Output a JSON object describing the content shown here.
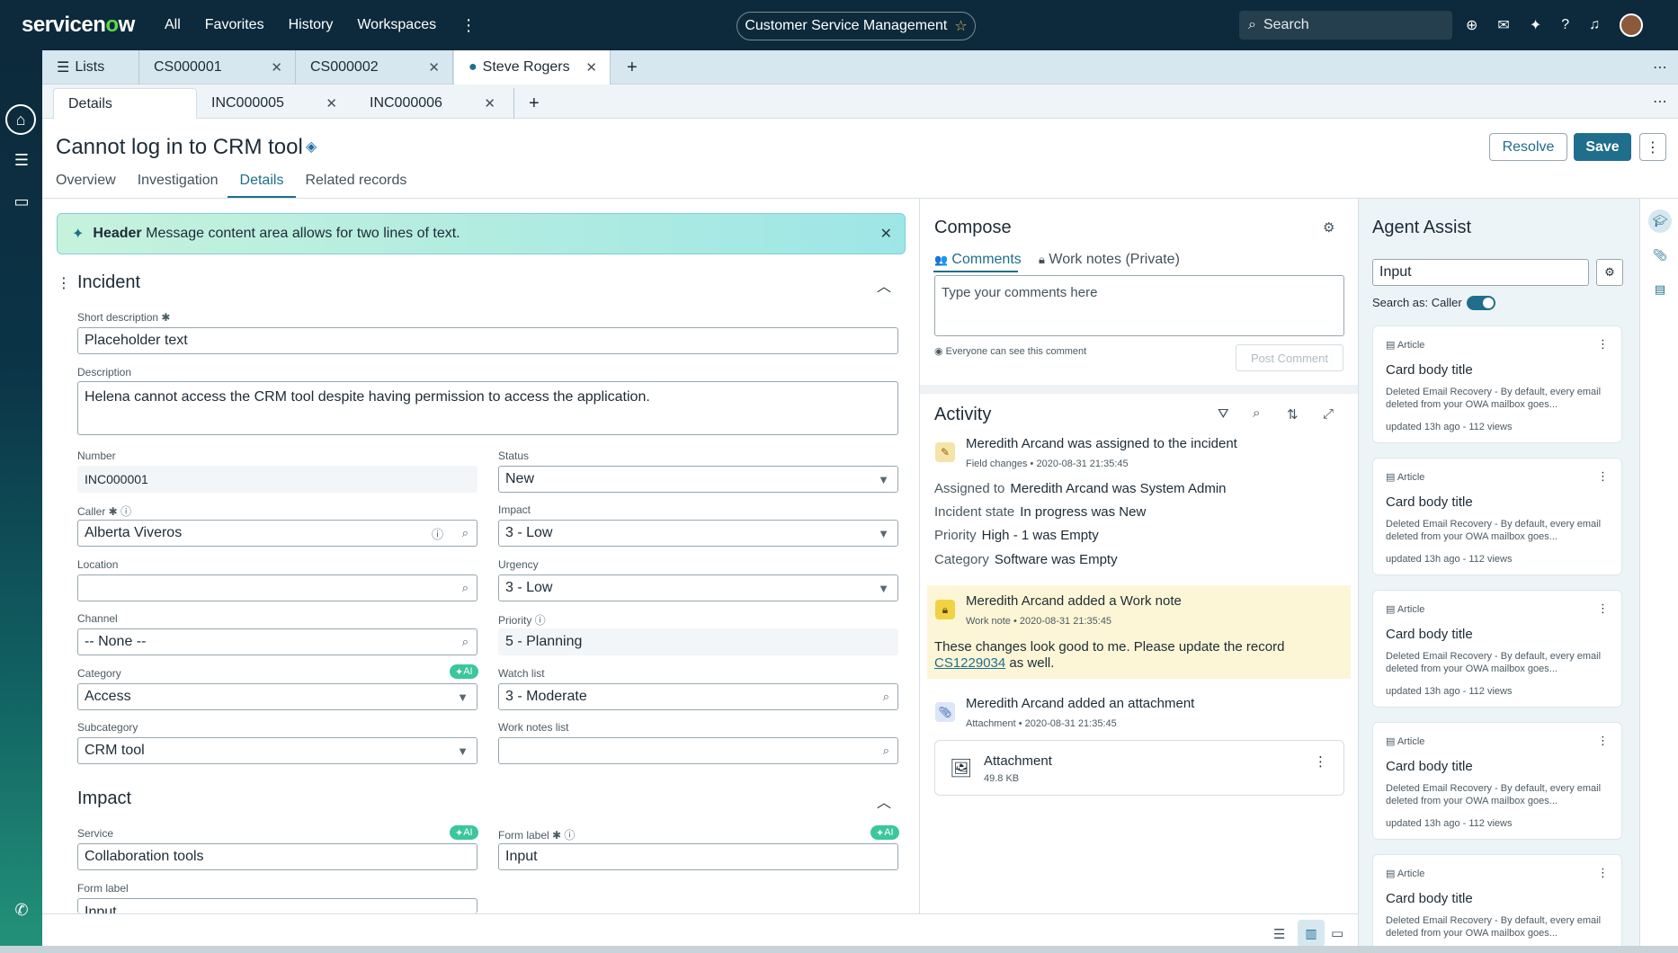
{
  "topbar": {
    "logo": "servicenow",
    "nav": [
      "All",
      "Favorites",
      "History",
      "Workspaces"
    ],
    "workspace": "Customer Service Management",
    "search_placeholder": "Search"
  },
  "tabs_primary": [
    {
      "label": "Lists",
      "icon": "list-icon"
    },
    {
      "label": "CS000001"
    },
    {
      "label": "CS000002"
    },
    {
      "label": "Steve Rogers",
      "icon": "chat-icon",
      "active": true
    }
  ],
  "tabs_secondary": [
    {
      "label": "Details",
      "active": true
    },
    {
      "label": "INC000005"
    },
    {
      "label": "INC000006"
    }
  ],
  "record": {
    "title": "Cannot log in to CRM tool",
    "resolve_label": "Resolve",
    "save_label": "Save",
    "subtabs": [
      "Overview",
      "Investigation",
      "Details",
      "Related records"
    ],
    "active_subtab": "Details"
  },
  "banner": {
    "header": "Header",
    "message": "Message content area allows for two lines of text."
  },
  "incident": {
    "section_title": "Incident",
    "short_description_label": "Short description",
    "short_description": "Placeholder text",
    "description_label": "Description",
    "description": "Helena cannot access the CRM tool despite having permission to access the application.",
    "number_label": "Number",
    "number": "INC000001",
    "status_label": "Status",
    "status": "New",
    "caller_label": "Caller",
    "caller": "Alberta Viveros",
    "impact_label": "Impact",
    "impact": "3 - Low",
    "location_label": "Location",
    "location": "",
    "urgency_label": "Urgency",
    "urgency": "3 - Low",
    "channel_label": "Channel",
    "channel": "-- None --",
    "priority_label": "Priority",
    "priority": "5 - Planning",
    "category_label": "Category",
    "category": "Access",
    "watch_list_label": "Watch list",
    "watch_list": "3 - Moderate",
    "subcategory_label": "Subcategory",
    "subcategory": "CRM tool",
    "work_notes_list_label": "Work notes list",
    "work_notes_list": "",
    "ai_badge": "AI"
  },
  "impact_section": {
    "section_title": "Impact",
    "service_label": "Service",
    "service": "Collaboration tools",
    "form_label_1": "Form label",
    "form_value_1": "Input",
    "form_label_2": "Form label",
    "form_value_2": "Input"
  },
  "compose": {
    "title": "Compose",
    "tab_comments": "Comments",
    "tab_worknotes": "Work notes (Private)",
    "placeholder": "Type your comments here",
    "visibility_note": "Everyone can see this comment",
    "post_label": "Post Comment"
  },
  "activity": {
    "title": "Activity",
    "entries": [
      {
        "title": "Meredith Arcand was assigned to the incident",
        "type": "Field changes",
        "time": "2020-08-31 21:35:45",
        "changes": [
          {
            "k": "Assigned to",
            "v": "Meredith Arcand was System Admin"
          },
          {
            "k": "Incident state",
            "v": "In progress was New"
          },
          {
            "k": "Priority",
            "v": "High - 1 was Empty"
          },
          {
            "k": "Category",
            "v": "Software was Empty"
          }
        ]
      },
      {
        "title": "Meredith Arcand added a Work note",
        "type": "Work note",
        "time": "2020-08-31 21:35:45",
        "text_before": "These changes look good to me. Please update the record",
        "link": "CS1229034",
        "text_after": "as well."
      },
      {
        "title": "Meredith Arcand added an attachment",
        "type": "Attachment",
        "time": "2020-08-31 21:35:45",
        "file_name": "Attachment",
        "file_size": "49.8 KB"
      }
    ]
  },
  "agent_assist": {
    "title": "Agent Assist",
    "input": "Input",
    "search_as": "Search as: Caller",
    "cards": [
      {
        "type": "Article",
        "title": "Card body title",
        "body": "Deleted Email Recovery - By default, every email deleted from your OWA mailbox goes...",
        "meta": "updated 13h ago - 112 views"
      },
      {
        "type": "Article",
        "title": "Card body title",
        "body": "Deleted Email Recovery - By default, every email deleted from your OWA mailbox goes...",
        "meta": "updated 13h ago - 112 views"
      },
      {
        "type": "Article",
        "title": "Card body title",
        "body": "Deleted Email Recovery - By default, every email deleted from your OWA mailbox goes...",
        "meta": "updated 13h ago - 112 views"
      },
      {
        "type": "Article",
        "title": "Card body title",
        "body": "Deleted Email Recovery - By default, every email deleted from your OWA mailbox goes...",
        "meta": "updated 13h ago - 112 views"
      },
      {
        "type": "Article",
        "title": "Card body title",
        "body": "Deleted Email Recovery - By default, every email deleted from your OWA mailbox goes...",
        "meta": ""
      }
    ]
  },
  "colors": {
    "topbar": "#0c2a3b",
    "accent": "#1f6e8c",
    "brand_green": "#62d84e",
    "ai_badge": "#3ac79b",
    "worknote_bg": "#fdf6d6"
  }
}
